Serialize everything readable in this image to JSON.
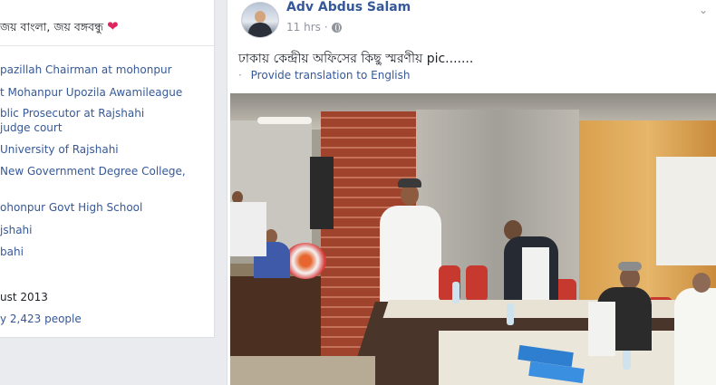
{
  "intro": {
    "bio": "জয় বাংলা, জয় বঙ্গবন্ধু",
    "bio_icon": "heart-icon",
    "items": [
      {
        "text": "pazillah Chairman at mohonpur"
      },
      {
        "text": "t Mohanpur Upozila Awamileague"
      },
      {
        "text": "blic Prosecutor at Rajshahi"
      },
      {
        "text": " judge court"
      },
      {
        "text": "University of Rajshahi"
      },
      {
        "text": "New Government Degree College,"
      },
      {
        "text": "ohonpur Govt High School"
      },
      {
        "text": "jshahi"
      },
      {
        "text": "bahi"
      },
      {
        "text": "ust 2013"
      },
      {
        "text": "y 2,423 people"
      }
    ]
  },
  "post": {
    "author": "Adv Abdus Salam",
    "time": "11 hrs",
    "time_separator": "·",
    "privacy_icon": "globe-icon",
    "menu_icon": "chevron-down-icon",
    "text": "ঢাকায় কেন্দ্রীয় অফিসের কিছু স্মরণীয় pic.......",
    "translate_dot": "·",
    "translate_label": "Provide translation to English"
  },
  "colors": {
    "link": "#365899",
    "text": "#1d2129",
    "meta": "#90949c",
    "background": "#e9ebee"
  }
}
